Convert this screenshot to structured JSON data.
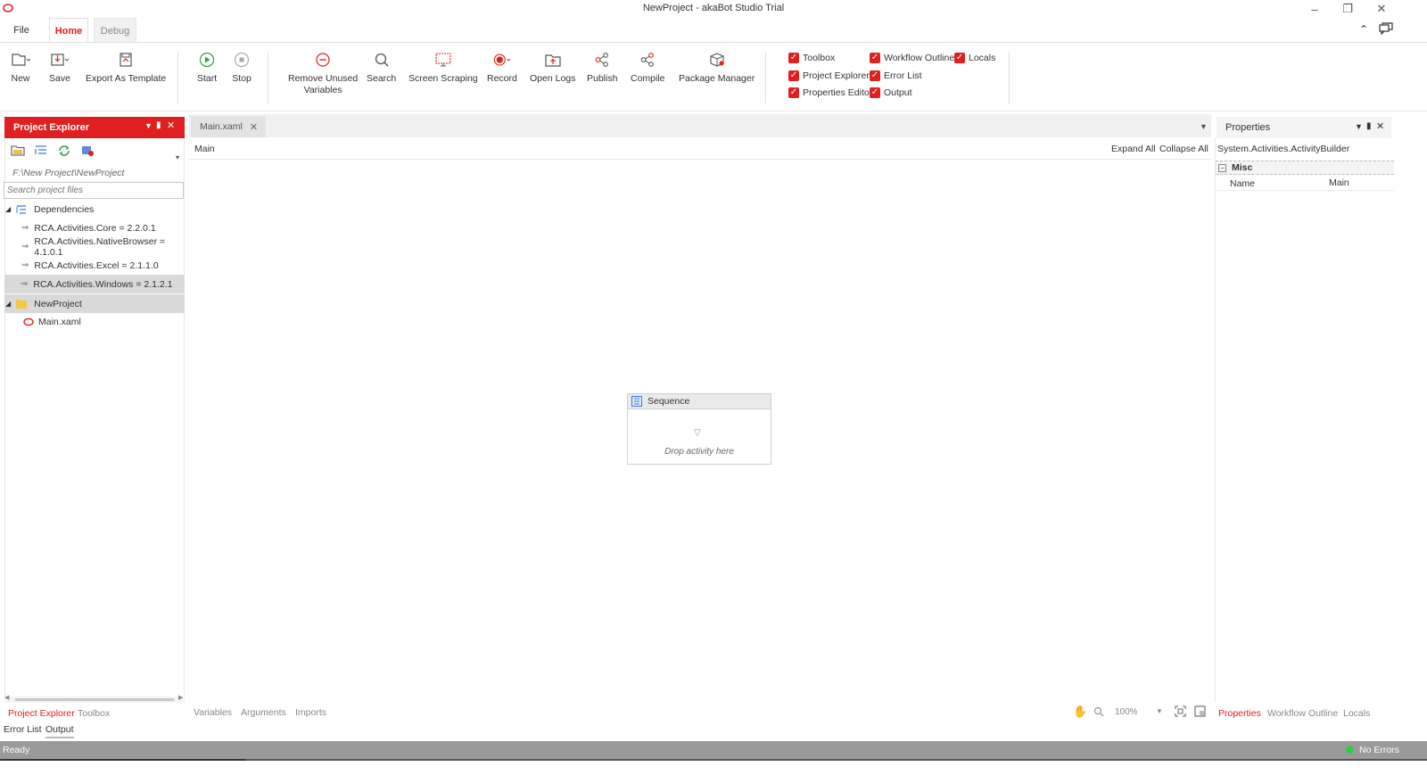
{
  "window": {
    "title": "NewProject - akaBot Studio Trial"
  },
  "ribbon_tabs": [
    "File",
    "Home",
    "Debug"
  ],
  "ribbon": {
    "new": "New",
    "save": "Save",
    "export_template": "Export As Template",
    "start": "Start",
    "stop": "Stop",
    "remove_unused_1": "Remove Unused",
    "remove_unused_2": "Variables",
    "search": "Search",
    "screen_scraping": "Screen Scraping",
    "record": "Record",
    "open_logs": "Open Logs",
    "publish": "Publish",
    "compile": "Compile",
    "package_manager": "Package Manager"
  },
  "panel_toggles": {
    "toolbox": "Toolbox",
    "project_explorer": "Project Explorer",
    "properties_editor": "Properties Editor",
    "workflow_outline": "Workflow Outline",
    "error_list": "Error List",
    "output": "Output",
    "locals": "Locals"
  },
  "project_explorer": {
    "title": "Project Explorer",
    "path": "F:\\New Project\\NewProject",
    "search_placeholder": "Search project files",
    "dependencies_label": "Dependencies",
    "dependencies": [
      "RCA.Activities.Core = 2.2.0.1",
      "RCA.Activities.NativeBrowser = 4.1.0.1",
      "RCA.Activities.Excel = 2.1.1.0",
      "RCA.Activities.Windows = 2.1.2.1"
    ],
    "project_folder": "NewProject",
    "main_file": "Main.xaml",
    "bottom_tabs": [
      "Project Explorer",
      "Toolbox"
    ],
    "lower_tabs": [
      "Error List",
      "Output"
    ]
  },
  "document": {
    "tab_label": "Main.xaml",
    "breadcrumb": "Main",
    "expand_all": "Expand All",
    "collapse_all": "Collapse All",
    "sequence_title": "Sequence",
    "drop_hint": "Drop activity here",
    "bottom_tabs": [
      "Variables",
      "Arguments",
      "Imports"
    ],
    "zoom": "100%"
  },
  "properties": {
    "title": "Properties",
    "type_name": "System.Activities.ActivityBuilder",
    "category": "Misc",
    "name_label": "Name",
    "name_value": "Main",
    "bottom_tabs": [
      "Properties",
      "Workflow Outline",
      "Locals"
    ]
  },
  "status": {
    "left": "Ready",
    "right": "No Errors"
  },
  "colors": {
    "accent": "#e02020",
    "status_bar": "#9a9a9a",
    "ok_dot": "#2ecc40"
  }
}
